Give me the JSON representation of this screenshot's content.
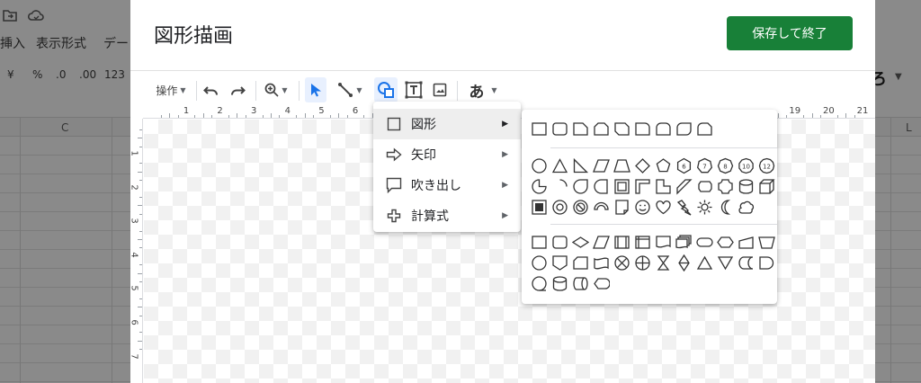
{
  "background": {
    "menubar": [
      "挿入",
      "表示形式",
      "デー"
    ],
    "format_toolbar": [
      "¥",
      "%",
      ".0",
      ".00",
      "123"
    ],
    "columns": [
      "C",
      "L"
    ],
    "cut_text": "ろ"
  },
  "dialog": {
    "title": "図形描画",
    "save_button": "保存して終了",
    "toolbar": {
      "actions_label": "操作",
      "text_style_glyph": "あ"
    },
    "ruler_h": [
      "1",
      "2",
      "3",
      "4",
      "5",
      "6",
      "",
      "",
      "",
      "",
      "",
      "",
      "",
      "",
      "",
      "",
      "",
      "",
      "19",
      "20",
      "21"
    ],
    "ruler_v": [
      "1",
      "2",
      "3",
      "4",
      "5",
      "6",
      "7"
    ]
  },
  "menu": {
    "items": [
      {
        "label": "図形",
        "icon": "square-icon",
        "active": true
      },
      {
        "label": "矢印",
        "icon": "arrow-right-icon",
        "active": false
      },
      {
        "label": "吹き出し",
        "icon": "callout-icon",
        "active": false
      },
      {
        "label": "計算式",
        "icon": "plus-icon",
        "active": false
      }
    ]
  },
  "shapes_submenu": {
    "group1": [
      "rectangle",
      "rounded-rectangle",
      "snip-single-corner",
      "snip-same-side",
      "snip-diagonal",
      "round-single-corner",
      "round-same-side",
      "round-diagonal",
      "snip-round"
    ],
    "group2": [
      "ellipse",
      "triangle",
      "right-triangle",
      "parallelogram",
      "trapezoid",
      "diamond",
      "pentagon",
      "hexagon-6",
      "heptagon-7",
      "octagon-8",
      "decagon-10",
      "dodecagon-12",
      "pie",
      "arc",
      "teardrop",
      "frame-half",
      "frame",
      "l-shape",
      "half-frame",
      "diagonal-stripe",
      "chord",
      "plaque",
      "can",
      "cube",
      "bevel",
      "donut",
      "no-symbol",
      "block-arc",
      "folded-corner",
      "smiley",
      "heart",
      "lightning",
      "sun",
      "moon",
      "cloud"
    ],
    "group3": [
      "flow-process",
      "flow-alternate",
      "flow-decision",
      "flow-data",
      "flow-predefined",
      "flow-internal-storage",
      "flow-document",
      "flow-multidocument",
      "flow-terminator",
      "flow-preparation",
      "flow-manual-input",
      "flow-manual-operation",
      "flow-connector",
      "flow-offpage",
      "flow-card",
      "flow-punched-tape",
      "flow-summing-junction",
      "flow-or",
      "flow-collate",
      "flow-sort",
      "flow-extract",
      "flow-merge",
      "flow-stored-data",
      "flow-delay",
      "flow-sequential-access",
      "flow-magnetic-disk",
      "flow-direct-access",
      "flow-display"
    ]
  }
}
